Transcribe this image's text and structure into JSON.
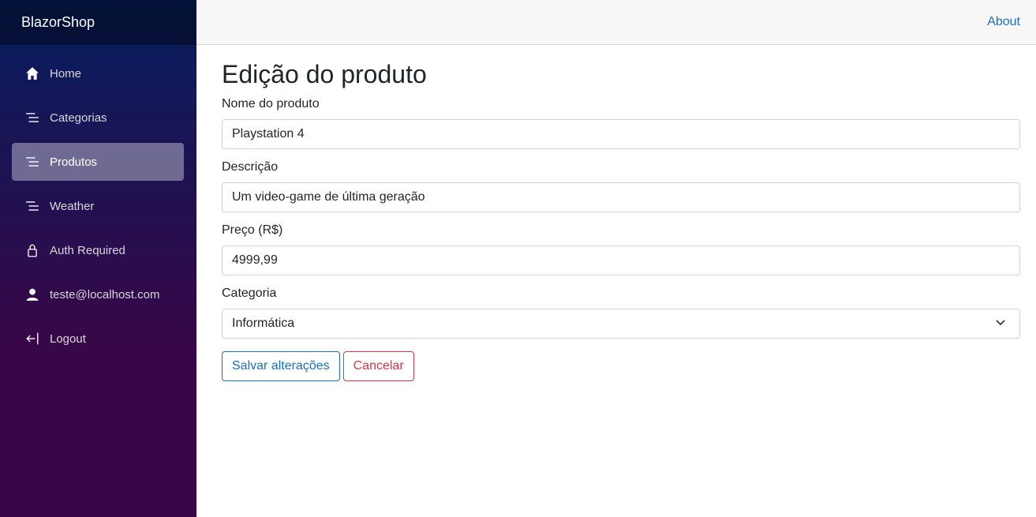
{
  "sidebar": {
    "brand": "BlazorShop",
    "items": [
      {
        "label": "Home",
        "icon": "home-icon"
      },
      {
        "label": "Categorias",
        "icon": "list-icon"
      },
      {
        "label": "Produtos",
        "icon": "list-icon",
        "active": true
      },
      {
        "label": "Weather",
        "icon": "list-icon"
      },
      {
        "label": "Auth Required",
        "icon": "lock-icon"
      },
      {
        "label": "teste@localhost.com",
        "icon": "person-icon"
      },
      {
        "label": "Logout",
        "icon": "logout-icon"
      }
    ]
  },
  "topbar": {
    "about": "About"
  },
  "form": {
    "title": "Edição do produto",
    "name_label": "Nome do produto",
    "name_value": "Playstation 4",
    "description_label": "Descrição",
    "description_value": "Um video-game de última geração",
    "price_label": "Preço (R$)",
    "price_value": "4999,99",
    "category_label": "Categoria",
    "category_value": "Informática",
    "save_label": "Salvar alterações",
    "cancel_label": "Cancelar"
  },
  "colors": {
    "accent": "#1b6ec2",
    "danger": "#dc3545",
    "sidebar_top": "#051e5e",
    "sidebar_bottom": "#3a0647"
  }
}
